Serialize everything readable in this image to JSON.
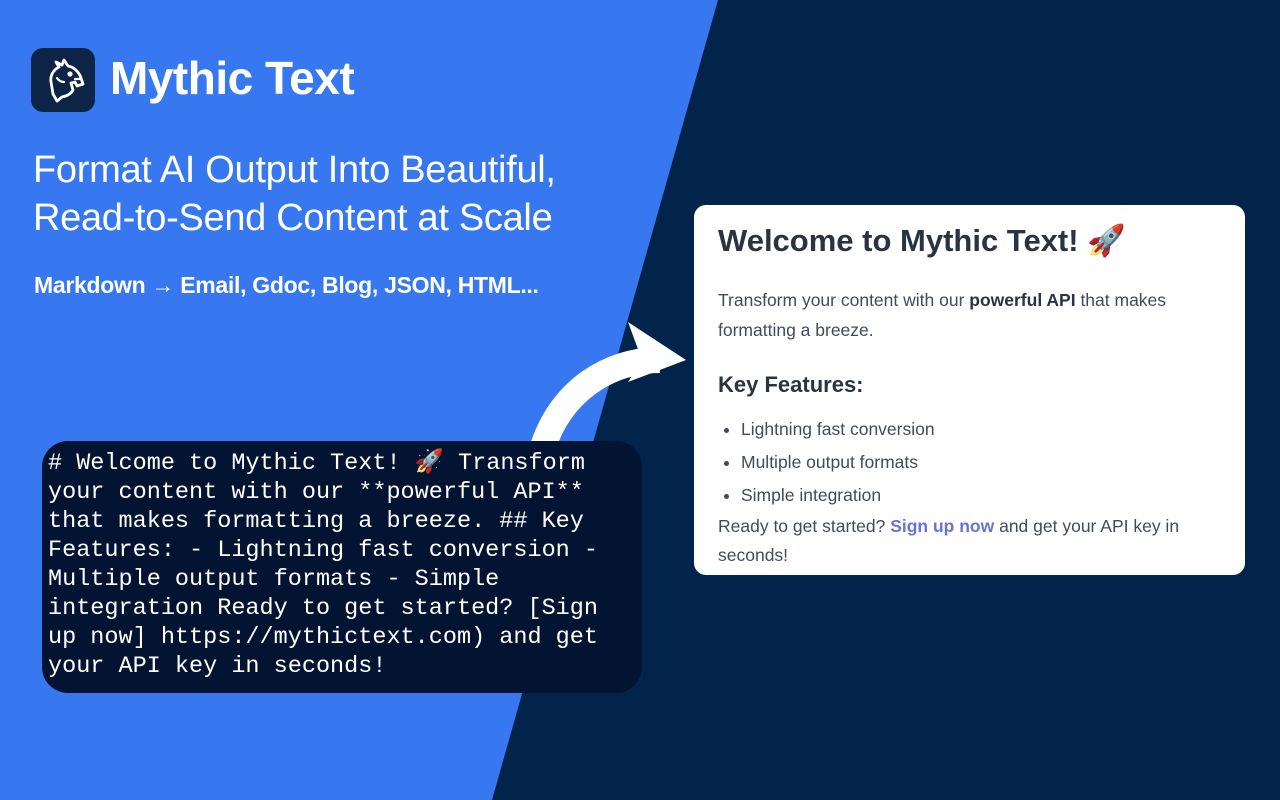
{
  "brand": {
    "name": "Mythic Text",
    "logo_icon": "dragon-icon"
  },
  "hero": {
    "headline_line1": "Format AI Output Into Beautiful,",
    "headline_line2": "Read-to-Send Content at Scale",
    "formats": "Markdown → Email, Gdoc, Blog, JSON, HTML..."
  },
  "markdown_source": "# Welcome to Mythic Text! 🚀 Transform your content with our **powerful API** that makes formatting a breeze. ## Key Features: - Lightning fast conversion - Multiple output formats - Simple integration Ready to get started? [Sign up now] https://mythictext.com) and get your API key in seconds!",
  "preview": {
    "title": "Welcome to Mythic Text! 🚀",
    "intro_before": "Transform your content with our ",
    "intro_bold": "powerful API",
    "intro_after": " that makes formatting a breeze.",
    "subtitle": "Key Features:",
    "features": [
      "Lightning fast conversion",
      "Multiple output formats",
      "Simple integration"
    ],
    "cta_before": "Ready to get started? ",
    "cta_link": "Sign up now",
    "cta_after": " and get your API key in seconds!"
  },
  "colors": {
    "left_bg": "#3778f0",
    "right_bg": "#03244a",
    "code_bg": "#021431",
    "link": "#6574d6"
  },
  "icons": {
    "transition": "curved-arrow-icon"
  }
}
